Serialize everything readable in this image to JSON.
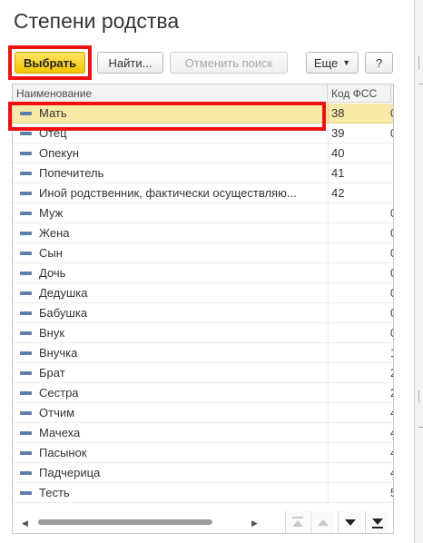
{
  "window": {
    "title": "Степени родства"
  },
  "toolbar": {
    "select_label": "Выбрать",
    "find_label": "Найти...",
    "cancel_search_label": "Отменить поиск",
    "more_label": "Еще",
    "help_label": "?"
  },
  "table": {
    "columns": {
      "name": "Наименование",
      "code": "Код ФСС"
    },
    "rows": [
      {
        "name": "Мать",
        "code": "38",
        "extra": "0"
      },
      {
        "name": "Отец",
        "code": "39",
        "extra": "0"
      },
      {
        "name": "Опекун",
        "code": "40",
        "extra": ""
      },
      {
        "name": "Попечитель",
        "code": "41",
        "extra": ""
      },
      {
        "name": "Иной родственник, фактически осуществляю...",
        "code": "42",
        "extra": ""
      },
      {
        "name": "Муж",
        "code": "",
        "extra": "0"
      },
      {
        "name": "Жена",
        "code": "",
        "extra": "0"
      },
      {
        "name": "Сын",
        "code": "",
        "extra": "0"
      },
      {
        "name": "Дочь",
        "code": "",
        "extra": "0"
      },
      {
        "name": "Дедушка",
        "code": "",
        "extra": "0"
      },
      {
        "name": "Бабушка",
        "code": "",
        "extra": "0"
      },
      {
        "name": "Внук",
        "code": "",
        "extra": "0"
      },
      {
        "name": "Внучка",
        "code": "",
        "extra": "1"
      },
      {
        "name": "Брат",
        "code": "",
        "extra": "2"
      },
      {
        "name": "Сестра",
        "code": "",
        "extra": "2"
      },
      {
        "name": "Отчим",
        "code": "",
        "extra": "4"
      },
      {
        "name": "Мачеха",
        "code": "",
        "extra": "4"
      },
      {
        "name": "Пасынок",
        "code": "",
        "extra": "4"
      },
      {
        "name": "Падчерица",
        "code": "",
        "extra": "4"
      },
      {
        "name": "Тесть",
        "code": "",
        "extra": "5"
      }
    ],
    "selected_index": 0
  },
  "colors": {
    "accent": "#f3c400",
    "highlight": "#ee1111",
    "selected_row": "#f9e9a7",
    "row_icon": "#5b7fa8"
  },
  "icons": {
    "row": "minus-icon",
    "more_dropdown": "chevron-down-icon",
    "scroll_left": "arrow-left-icon",
    "scroll_right": "arrow-right-icon",
    "nav_first": "jump-to-top-icon",
    "nav_up": "arrow-up-icon",
    "nav_down": "arrow-down-icon",
    "nav_last": "jump-to-bottom-icon"
  }
}
